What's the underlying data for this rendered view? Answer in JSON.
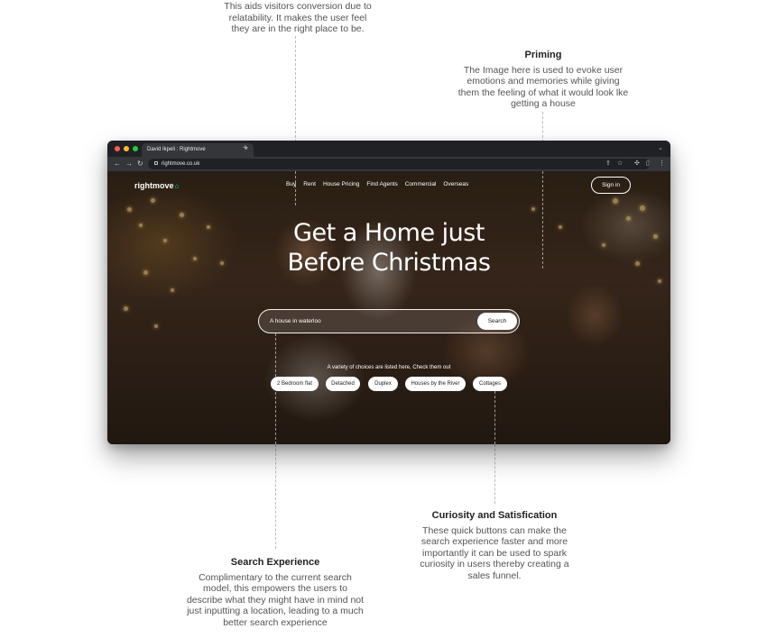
{
  "annotations": {
    "relatability": {
      "body": "This aids visitors conversion due to\nrelatability. It makes the user feel\nthey are in the right place to be."
    },
    "priming": {
      "title": "Priming",
      "body": "The Image here is used to evoke user\nemotions and memories while giving\nthem the feeling of what it would look lke\ngetting a house"
    },
    "curiosity": {
      "title": "Curiosity and Satisfication",
      "body": "These quick buttons can make the\nsearch experience faster and more\nimportantly it can be used to spark\ncuriosity in users thereby creating a\nsales funnel."
    },
    "search_experience": {
      "title": "Search Experience",
      "body": "Complimentary to the current search\nmodel, this empowers the users to\ndescribe what they might have in mind not\njust inputting a location, leading to a much\nbetter search experience"
    }
  },
  "browser": {
    "tab_title": "David Ikpeli : Rightmove",
    "url": "rightmove.co.uk"
  },
  "site": {
    "logo": "rightmove",
    "nav": [
      "Buy",
      "Rent",
      "House Pricing",
      "Find Agents",
      "Commercial",
      "Overseas"
    ],
    "sign_in": "Sign in",
    "headline_line1": "Get a Home just",
    "headline_line2": "Before Christmas",
    "search_value": "A house in waterloo",
    "search_button": "Search",
    "choices_caption": "A variety of choices are listed here, Check them out",
    "chips": [
      "2 Bedroom flat",
      "Detached",
      "Duplex",
      "Houses by the River",
      "Cottages"
    ]
  }
}
